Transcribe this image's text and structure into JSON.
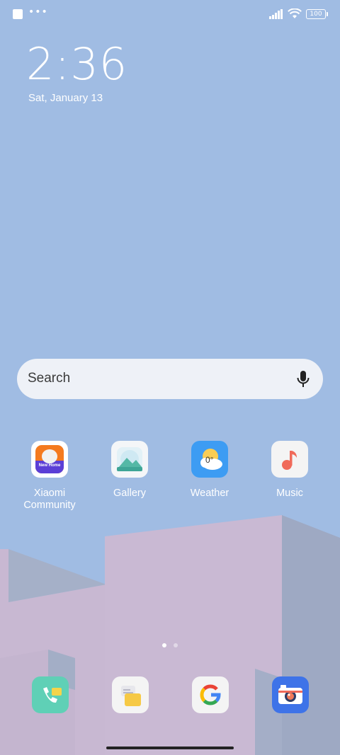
{
  "status_bar": {
    "battery": "100"
  },
  "lock": {
    "time": "2:36",
    "date": "Sat, January 13"
  },
  "search": {
    "placeholder": "Search"
  },
  "apps": [
    {
      "label": "Xiaomi\nCommunity",
      "icon": "xiaomi-community-icon",
      "badge_text": "New Home"
    },
    {
      "label": "Gallery",
      "icon": "gallery-icon"
    },
    {
      "label": "Weather",
      "icon": "weather-icon",
      "temp": "0°"
    },
    {
      "label": "Music",
      "icon": "music-icon"
    }
  ],
  "dock": [
    {
      "icon": "phone-icon"
    },
    {
      "icon": "messages-icon"
    },
    {
      "icon": "google-icon"
    },
    {
      "icon": "camera-icon"
    }
  ],
  "pager": {
    "pages": 2,
    "current": 1
  },
  "colors": {
    "sky": "#a0bce3",
    "wall_pink": "#c9b8d3",
    "wall_grey": "#9aa9c4"
  }
}
